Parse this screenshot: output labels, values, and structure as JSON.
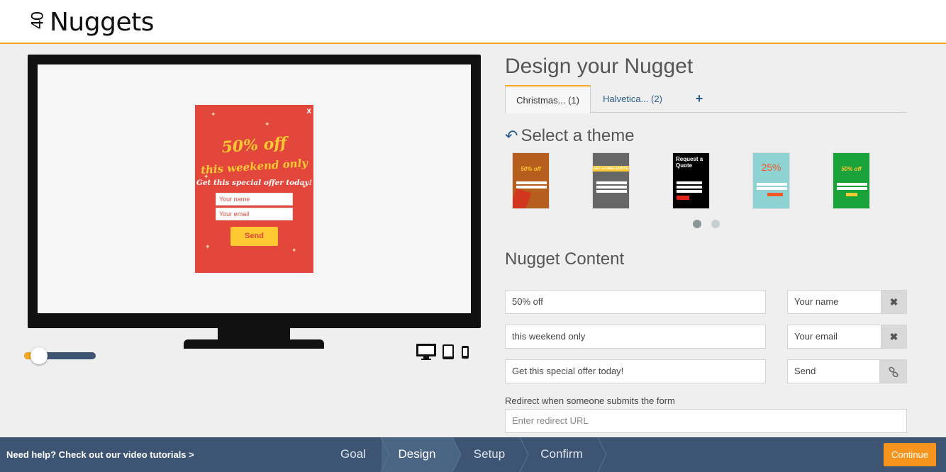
{
  "header": {
    "logo_mark": "40",
    "logo_text": "Nuggets"
  },
  "preview": {
    "close": "x",
    "headline": "50% off",
    "subheadline": "this weekend only",
    "tagline": "Get this special offer today!",
    "name_placeholder": "Your name",
    "email_placeholder": "Your email",
    "send_label": "Send",
    "zoom_level": 0.12
  },
  "design": {
    "title": "Design your Nugget",
    "tabs": [
      {
        "label": "Christmas... (1)"
      },
      {
        "label": "Halvetica... (2)"
      }
    ],
    "add_tab_icon": "+",
    "select_theme": "Select a theme",
    "themes": [
      {
        "name": "christmas-orange",
        "text": "50% off",
        "color": "#b55e1e"
      },
      {
        "name": "free-quote-grey",
        "text": "GET A FREE QUOTE",
        "color": "#666666"
      },
      {
        "name": "request-quote-black",
        "text": "Request a Quote",
        "color": "#000000"
      },
      {
        "name": "teal-25",
        "text": "25%",
        "color": "#8fd2d4"
      },
      {
        "name": "green-50",
        "text": "50% off",
        "color": "#1aa33a"
      }
    ],
    "carousel_pages": 2,
    "carousel_active": 1
  },
  "content": {
    "title": "Nugget Content",
    "fields": [
      "50% off",
      "this weekend only",
      "Get this special offer today!"
    ],
    "form_fields": [
      "Your name",
      "Your email",
      "Send"
    ],
    "redirect_label": "Redirect when someone submits the form",
    "redirect_placeholder": "Enter redirect URL"
  },
  "footer": {
    "help": "Need help? Check out our video tutorials >",
    "steps": [
      "Goal",
      "Design",
      "Setup",
      "Confirm"
    ],
    "active_step": "Design",
    "continue": "Continue"
  },
  "colors": {
    "accent": "#f5a623",
    "footer": "#3d5573",
    "popup": "#e3473c",
    "popup_text": "#ffc933",
    "link": "#2b5d8a"
  }
}
